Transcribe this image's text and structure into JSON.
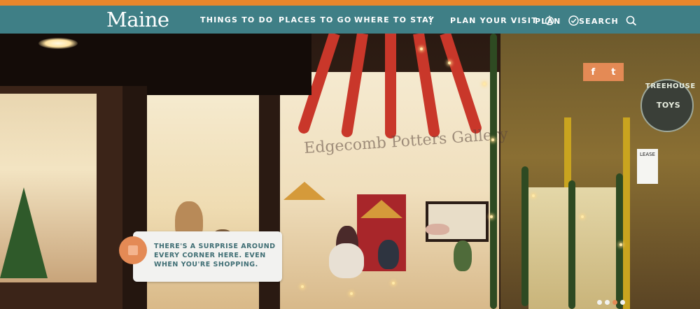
{
  "nav": {
    "logo": "Maine",
    "items": [
      {
        "label": "THINGS TO DO"
      },
      {
        "label": "PLACES TO GO"
      },
      {
        "label": "WHERE TO STAY"
      },
      {
        "label": "PLAN YOUR VISIT"
      },
      {
        "label": "PLAN"
      },
      {
        "label": "SEARCH"
      }
    ]
  },
  "hero": {
    "window_lettering": "Edgecomb Potters Gallery",
    "sign": {
      "line1": "TREEHOUSE",
      "line2": "TOYS"
    },
    "lease_sign": "LEASE"
  },
  "social": {
    "facebook": "f",
    "twitter": "t"
  },
  "caption": {
    "text": "THERE'S A SURPRISE AROUND EVERY CORNER HERE. EVEN WHEN YOU'RE SHOPPING."
  },
  "carousel": {
    "dot_count": 4,
    "active_index": 2
  },
  "colors": {
    "nav_bg": "#3f7f86",
    "accent_orange": "#e48a55",
    "top_stripe": "#e8862c",
    "caption_text": "#3f6e74"
  },
  "icons": {
    "plan_visit": "compass-icon",
    "plan": "check-circle-icon",
    "search": "search-icon"
  }
}
